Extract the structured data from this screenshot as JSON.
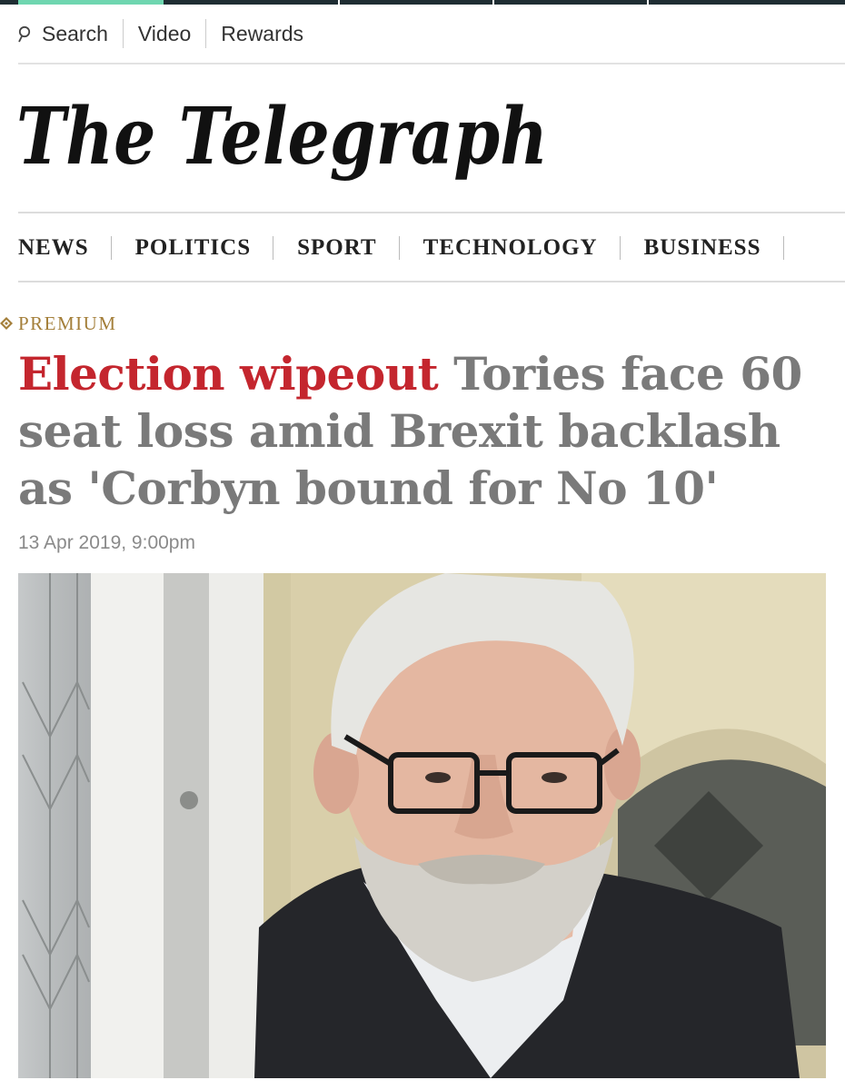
{
  "topbar": {
    "accent_color": "#6fd6b0",
    "bar_color": "#1f2d33"
  },
  "utility_nav": [
    {
      "label": "Search",
      "icon": "search-icon"
    },
    {
      "label": "Video"
    },
    {
      "label": "Rewards"
    }
  ],
  "masthead": {
    "title": "The Telegraph"
  },
  "section_nav": [
    "NEWS",
    "POLITICS",
    "SPORT",
    "TECHNOLOGY",
    "BUSINESS"
  ],
  "article": {
    "premium_label": "PREMIUM",
    "premium_icon": "premium-diamond-icon",
    "headline_kicker": "Election wipeout",
    "headline_rest": "Tories face 60 seat loss amid Brexit backlash as 'Corbyn bound for No 10'",
    "date": "13 Apr 2019, 9:00pm",
    "kicker_color": "#c4262e",
    "headline_color": "#7a7a7a",
    "premium_color": "#a47f3a"
  }
}
